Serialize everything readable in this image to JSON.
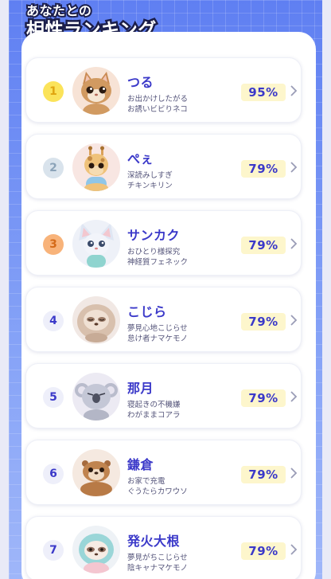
{
  "header": {
    "title_small": "あなたとの",
    "title_big": "相性ランキング"
  },
  "ranking": [
    {
      "rank": "1",
      "name": "つる",
      "desc1": "お出かけしたがる",
      "desc2": "お誘いビビりネコ",
      "score": "95%",
      "animal": "cat-icon",
      "rank_bg": "#fbe35a",
      "rank_fg": "#e0a40f"
    },
    {
      "rank": "2",
      "name": "ぺぇ",
      "desc1": "深読みしすぎ",
      "desc2": "チキンキリン",
      "score": "79%",
      "animal": "giraffe-icon",
      "rank_bg": "#d9e3ec",
      "rank_fg": "#8ba3b8"
    },
    {
      "rank": "3",
      "name": "サンカク",
      "desc1": "おひとり様探究",
      "desc2": "神経質フェネック",
      "score": "79%",
      "animal": "fennec-icon",
      "rank_bg": "#f8b37a",
      "rank_fg": "#d46a18"
    },
    {
      "rank": "4",
      "name": "こじら",
      "desc1": "夢見心地こじらせ",
      "desc2": "怠け者ナマケモノ",
      "score": "79%",
      "animal": "sloth-icon",
      "rank_bg": "#eeeffa",
      "rank_fg": "#3b39c9"
    },
    {
      "rank": "5",
      "name": "那月",
      "desc1": "寝起きの不機嫌",
      "desc2": "わがままコアラ",
      "score": "79%",
      "animal": "koala-icon",
      "rank_bg": "#eeeffa",
      "rank_fg": "#3b39c9"
    },
    {
      "rank": "6",
      "name": "鎌倉",
      "desc1": "お家で充電",
      "desc2": "ぐうたらカワウソ",
      "score": "79%",
      "animal": "otter-icon",
      "rank_bg": "#eeeffa",
      "rank_fg": "#3b39c9"
    },
    {
      "rank": "7",
      "name": "発火大根",
      "desc1": "夢見がちこじらせ",
      "desc2": "陰キャナマケモノ",
      "score": "79%",
      "animal": "sloth-icon",
      "rank_bg": "#eeeffa",
      "rank_fg": "#3b39c9"
    }
  ]
}
